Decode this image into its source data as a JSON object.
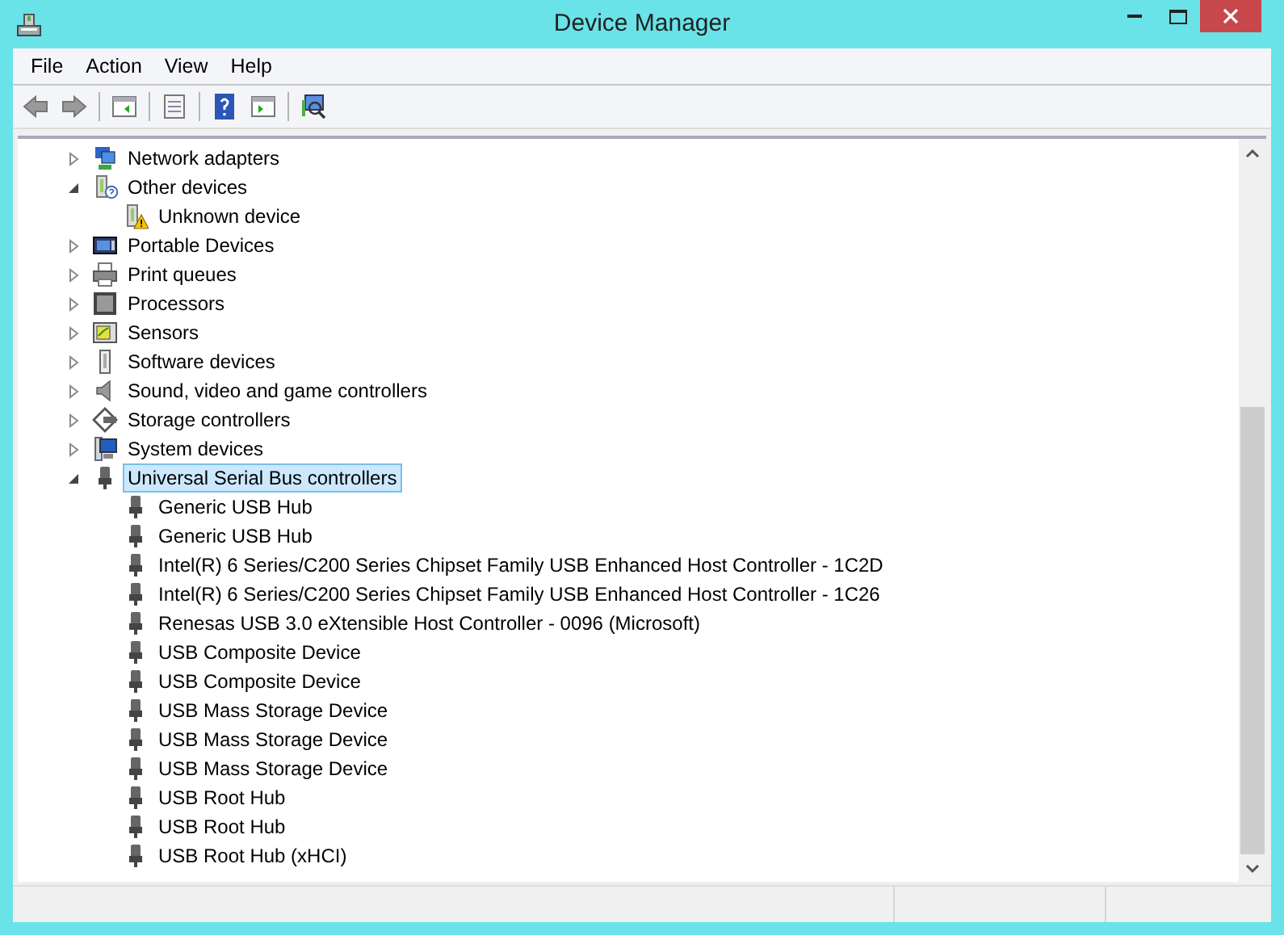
{
  "window": {
    "title": "Device Manager"
  },
  "menu": [
    "File",
    "Action",
    "View",
    "Help"
  ],
  "tree": [
    {
      "label": "Network adapters",
      "kind": "network",
      "expanded": false,
      "selected": false
    },
    {
      "label": "Other devices",
      "kind": "unknown",
      "expanded": true,
      "selected": false,
      "children": [
        {
          "label": "Unknown device",
          "kind": "warning",
          "selected": false
        }
      ]
    },
    {
      "label": "Portable Devices",
      "kind": "portable",
      "expanded": false,
      "selected": false
    },
    {
      "label": "Print queues",
      "kind": "printer",
      "expanded": false,
      "selected": false
    },
    {
      "label": "Processors",
      "kind": "cpu",
      "expanded": false,
      "selected": false
    },
    {
      "label": "Sensors",
      "kind": "sensor",
      "expanded": false,
      "selected": false
    },
    {
      "label": "Software devices",
      "kind": "software",
      "expanded": false,
      "selected": false
    },
    {
      "label": "Sound, video and game controllers",
      "kind": "sound",
      "expanded": false,
      "selected": false
    },
    {
      "label": "Storage controllers",
      "kind": "storage",
      "expanded": false,
      "selected": false
    },
    {
      "label": "System devices",
      "kind": "system",
      "expanded": false,
      "selected": false
    },
    {
      "label": "Universal Serial Bus controllers",
      "kind": "usb",
      "expanded": true,
      "selected": true,
      "children": [
        {
          "label": "Generic USB Hub",
          "kind": "usb",
          "selected": false
        },
        {
          "label": "Generic USB Hub",
          "kind": "usb",
          "selected": false
        },
        {
          "label": "Intel(R) 6 Series/C200 Series Chipset Family USB Enhanced Host Controller - 1C2D",
          "kind": "usb",
          "selected": false
        },
        {
          "label": "Intel(R) 6 Series/C200 Series Chipset Family USB Enhanced Host Controller - 1C26",
          "kind": "usb",
          "selected": false
        },
        {
          "label": "Renesas USB 3.0 eXtensible Host Controller - 0096 (Microsoft)",
          "kind": "usb",
          "selected": false
        },
        {
          "label": "USB Composite Device",
          "kind": "usb",
          "selected": false
        },
        {
          "label": "USB Composite Device",
          "kind": "usb",
          "selected": false
        },
        {
          "label": "USB Mass Storage Device",
          "kind": "usb",
          "selected": false
        },
        {
          "label": "USB Mass Storage Device",
          "kind": "usb",
          "selected": false
        },
        {
          "label": "USB Mass Storage Device",
          "kind": "usb",
          "selected": false
        },
        {
          "label": "USB Root Hub",
          "kind": "usb",
          "selected": false
        },
        {
          "label": "USB Root Hub",
          "kind": "usb",
          "selected": false
        },
        {
          "label": "USB Root Hub (xHCI)",
          "kind": "usb",
          "selected": false
        }
      ]
    }
  ]
}
